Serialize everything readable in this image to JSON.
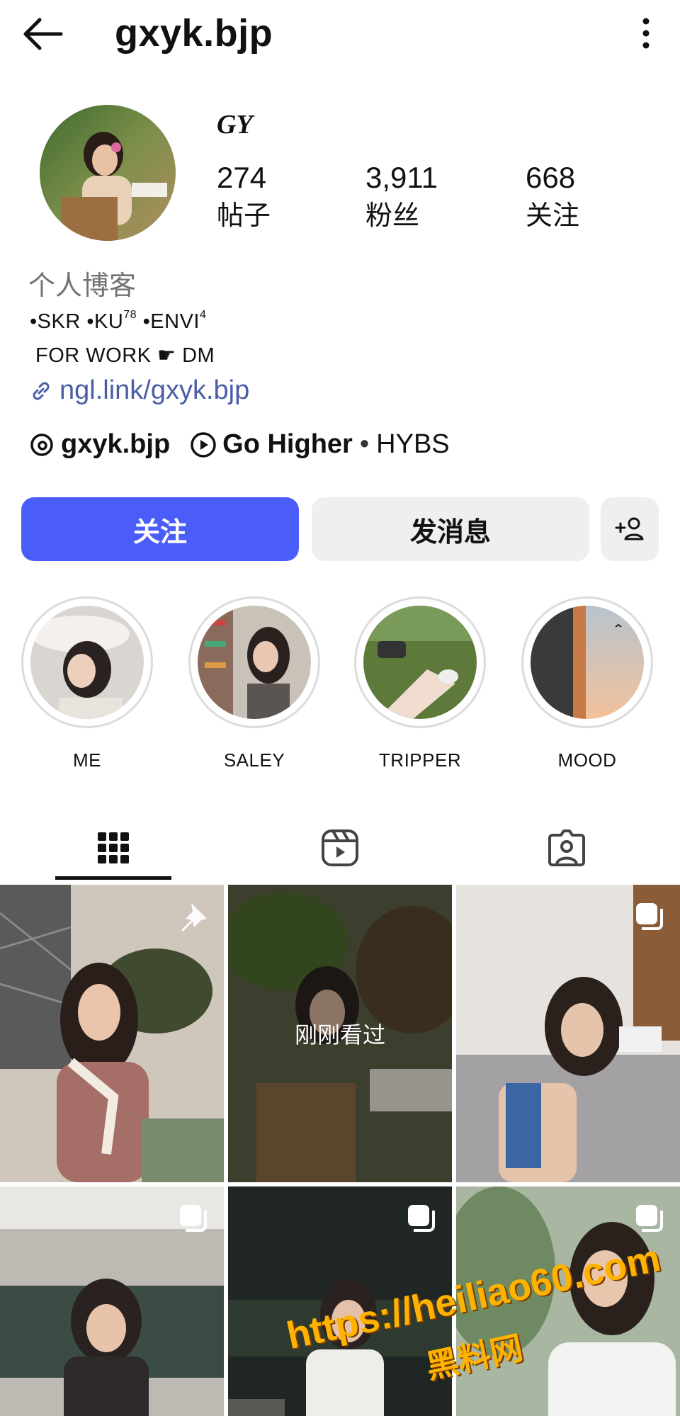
{
  "header": {
    "username": "gxyk.bjp"
  },
  "profile": {
    "display_name": "GY",
    "stats": [
      {
        "value": "274",
        "label": "帖子"
      },
      {
        "value": "3,911",
        "label": "粉丝"
      },
      {
        "value": "668",
        "label": "关注"
      }
    ],
    "category": "个人博客",
    "bio_line1_a": "•SKR •KU",
    "bio_line1_sup1": "78",
    "bio_line1_b": " •ENVI",
    "bio_line1_sup2": "4",
    "bio_line2": "FOR WORK ☛ DM",
    "link": "ngl.link/gxyk.bjp",
    "threads_handle": "gxyk.bjp",
    "music_title": "Go Higher",
    "music_artist": "HYBS"
  },
  "actions": {
    "follow_label": "关注",
    "message_label": "发消息"
  },
  "highlights": [
    {
      "label": "ME"
    },
    {
      "label": "SALEY"
    },
    {
      "label": "TRIPPER"
    },
    {
      "label": "MOOD"
    }
  ],
  "grid": {
    "seen_label": "刚刚看过"
  },
  "watermark": {
    "line1": "https://heiliao60.com",
    "line2": "黑料网"
  },
  "colors": {
    "follow_button": "#4a5df9",
    "link": "#4a5ea8",
    "secondary_button": "#efeff1"
  }
}
